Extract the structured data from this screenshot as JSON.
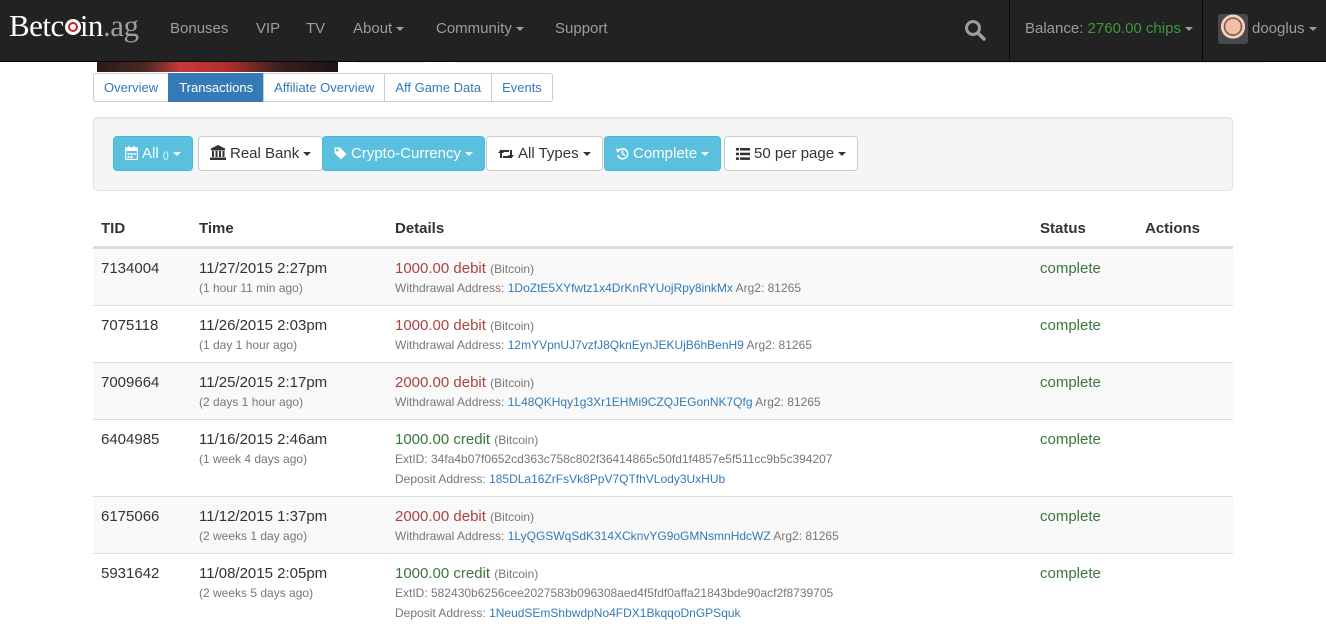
{
  "brand": {
    "name_prefix": "Betc",
    "name_suffix": "in",
    "tld": ".ag"
  },
  "nav": {
    "items": [
      "Bonuses",
      "VIP",
      "TV",
      "About",
      "Community",
      "Support"
    ],
    "balance_label": "Balance:",
    "balance_value": "2760.00 chips",
    "username": "dooglus"
  },
  "tabs": [
    "Overview",
    "Transactions",
    "Affiliate Overview",
    "Aff Game Data",
    "Events"
  ],
  "active_tab": "Transactions",
  "filters": {
    "all": "All",
    "all_count": "()",
    "bank": "Real Bank",
    "currency": "Crypto-Currency",
    "types": "All Types",
    "status": "Complete",
    "per_page": "50 per page"
  },
  "table": {
    "headers": [
      "TID",
      "Time",
      "Details",
      "Status",
      "Actions"
    ],
    "rows": [
      {
        "tid": "7134004",
        "time": "11/27/2015 2:27pm",
        "ago": "(1 hour 11 min ago)",
        "amount": "1000.00 debit",
        "kind": "debit",
        "currency": "(Bitcoin)",
        "line1_label": "Withdrawal Address:",
        "line1_addr": "1DoZtE5XYfwtz1x4DrKnRYUojRpy8inkMx",
        "line1_suffix": "Arg2: 81265",
        "line2_label": "",
        "line2_addr": "",
        "status": "complete"
      },
      {
        "tid": "7075118",
        "time": "11/26/2015 2:03pm",
        "ago": "(1 day 1 hour ago)",
        "amount": "1000.00 debit",
        "kind": "debit",
        "currency": "(Bitcoin)",
        "line1_label": "Withdrawal Address:",
        "line1_addr": "12mYVpnUJ7vzfJ8QknEynJEKUjB6hBenH9",
        "line1_suffix": "Arg2: 81265",
        "line2_label": "",
        "line2_addr": "",
        "status": "complete"
      },
      {
        "tid": "7009664",
        "time": "11/25/2015 2:17pm",
        "ago": "(2 days 1 hour ago)",
        "amount": "2000.00 debit",
        "kind": "debit",
        "currency": "(Bitcoin)",
        "line1_label": "Withdrawal Address:",
        "line1_addr": "1L48QKHqy1g3Xr1EHMi9CZQJEGonNK7Qfg",
        "line1_suffix": "Arg2: 81265",
        "line2_label": "",
        "line2_addr": "",
        "status": "complete"
      },
      {
        "tid": "6404985",
        "time": "11/16/2015 2:46am",
        "ago": "(1 week 4 days ago)",
        "amount": "1000.00 credit",
        "kind": "credit",
        "currency": "(Bitcoin)",
        "line1_label": "ExtID: 34fa4b07f0652cd363c758c802f36414865c50fd1f4857e5f511cc9b5c394207",
        "line1_addr": "",
        "line1_suffix": "",
        "line2_label": "Deposit Address:",
        "line2_addr": "185DLa16ZrFsVk8PpV7QTfhVLody3UxHUb",
        "status": "complete"
      },
      {
        "tid": "6175066",
        "time": "11/12/2015 1:37pm",
        "ago": "(2 weeks 1 day ago)",
        "amount": "2000.00 debit",
        "kind": "debit",
        "currency": "(Bitcoin)",
        "line1_label": "Withdrawal Address:",
        "line1_addr": "1LyQGSWqSdK314XCknvYG9oGMNsmnHdcWZ",
        "line1_suffix": "Arg2: 81265",
        "line2_label": "",
        "line2_addr": "",
        "status": "complete"
      },
      {
        "tid": "5931642",
        "time": "11/08/2015 2:05pm",
        "ago": "(2 weeks 5 days ago)",
        "amount": "1000.00 credit",
        "kind": "credit",
        "currency": "(Bitcoin)",
        "line1_label": "ExtID: 582430b6256cee2027583b096308aed4f5fdf0affa21843bde90acf2f8739705",
        "line1_addr": "",
        "line1_suffix": "",
        "line2_label": "Deposit Address:",
        "line2_addr": "1NeudSEmShbwdpNo4FDX1BkqqoDnGPSquk",
        "status": "complete"
      }
    ]
  },
  "colors": {
    "navbar": "#222222",
    "info_button": "#5bc0de",
    "debit": "#a94442",
    "credit": "#3c763d",
    "link": "#337ab7",
    "balance": "#3c9a3c"
  },
  "icons": {
    "search": "search-icon",
    "calendar": "calendar-icon",
    "bank": "bank-icon",
    "tag": "tag-icon",
    "retweet": "exchange-icon",
    "history": "history-icon",
    "list": "list-icon"
  }
}
